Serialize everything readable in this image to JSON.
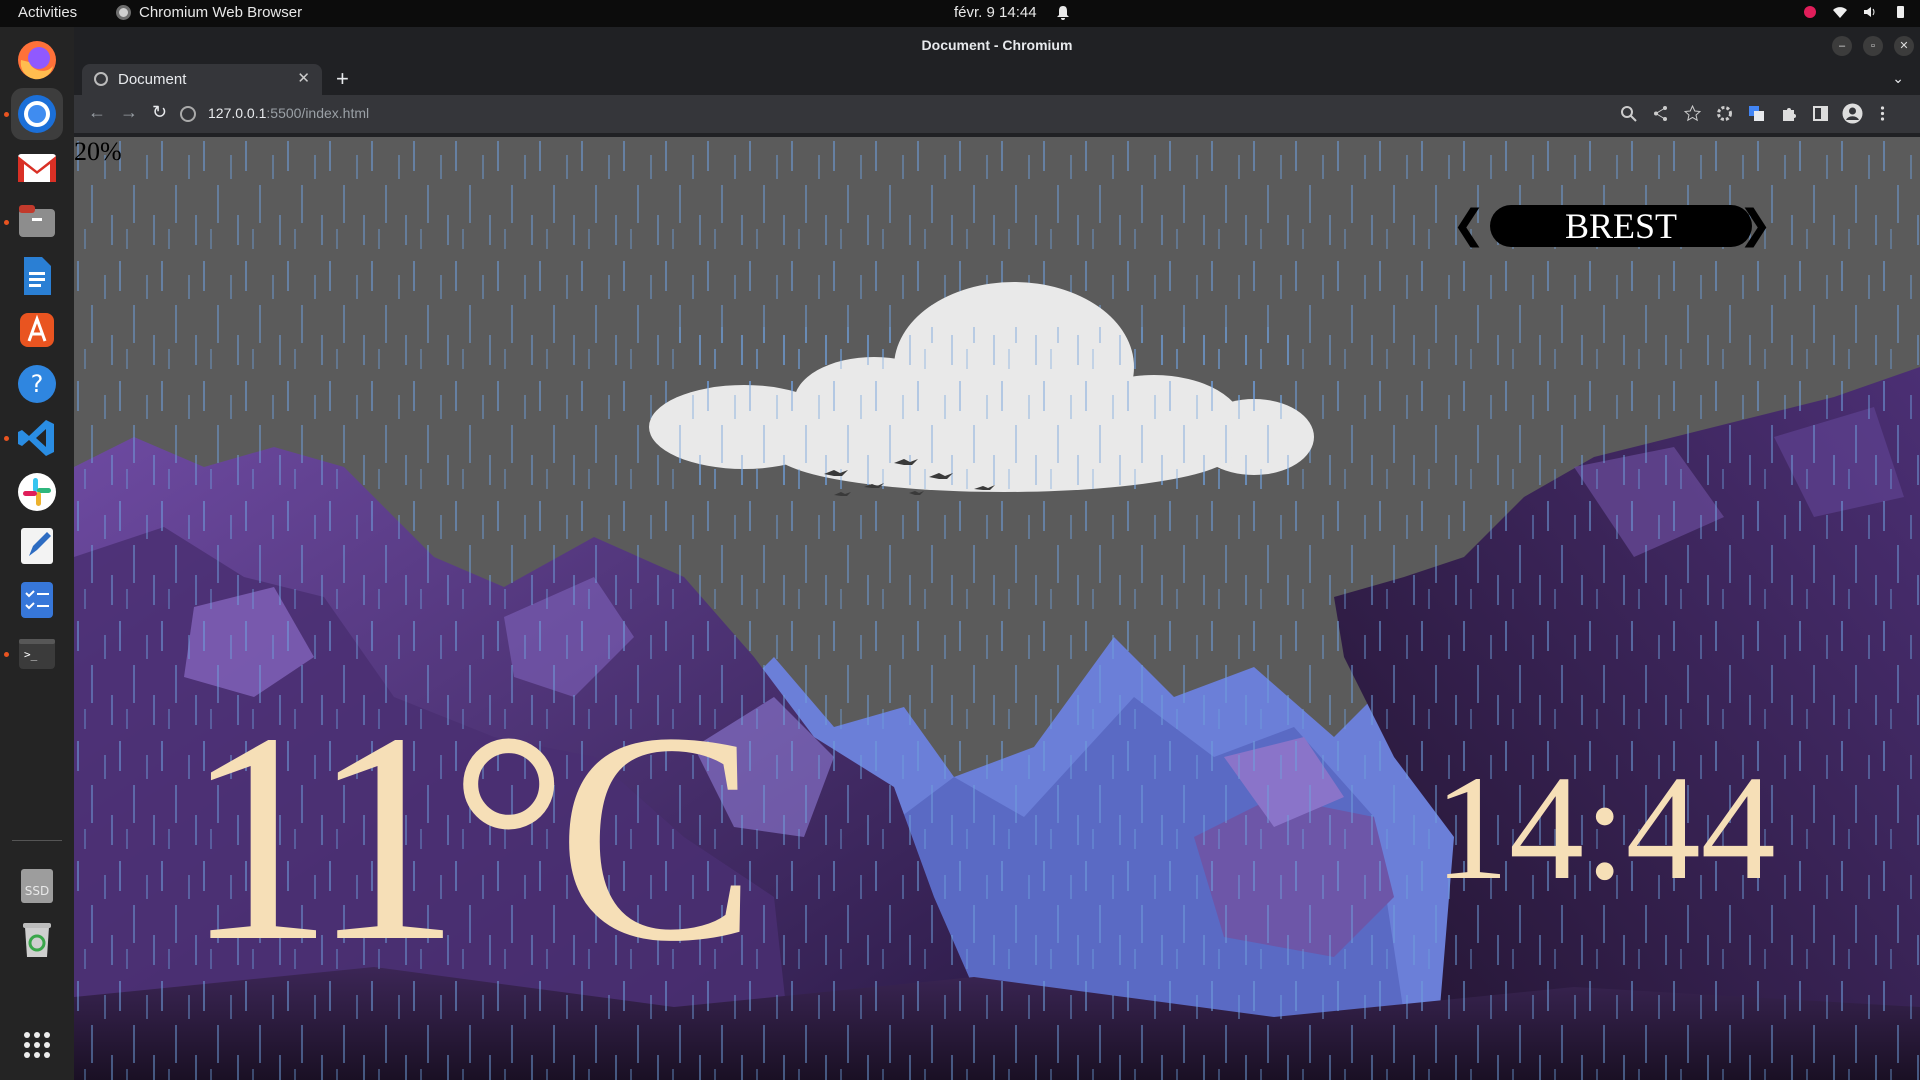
{
  "topbar": {
    "activities": "Activities",
    "app_name": "Chromium Web Browser",
    "clock": "févr. 9  14:44"
  },
  "dock": {
    "items": [
      "firefox-icon",
      "chromium-icon",
      "gmail-icon",
      "files-icon",
      "writer-icon",
      "app-center-icon",
      "help-icon",
      "vscode-icon",
      "slack-icon",
      "text-editor-icon",
      "todo-icon",
      "terminal-icon",
      "ssd-drive-icon",
      "trash-icon",
      "show-apps-icon"
    ],
    "ssd_label": "SSD"
  },
  "browser": {
    "window_title": "Document - Chromium",
    "tab_title": "Document",
    "url_host": "127.0.0.1",
    "url_rest": ":5500/index.html"
  },
  "page": {
    "percent": "20%",
    "city": "BREST",
    "temperature": "11°C",
    "time": "14:44",
    "prev_symbol": "❮",
    "next_symbol": "❯"
  },
  "colors": {
    "sky": "#5b5b5b",
    "rain": "#6f9fdc",
    "cloud": "#e9e9e9",
    "rock_purple": "#5a3d8a",
    "mountain_blue": "#6b7fd8",
    "text_cream": "#f6dfb7"
  }
}
